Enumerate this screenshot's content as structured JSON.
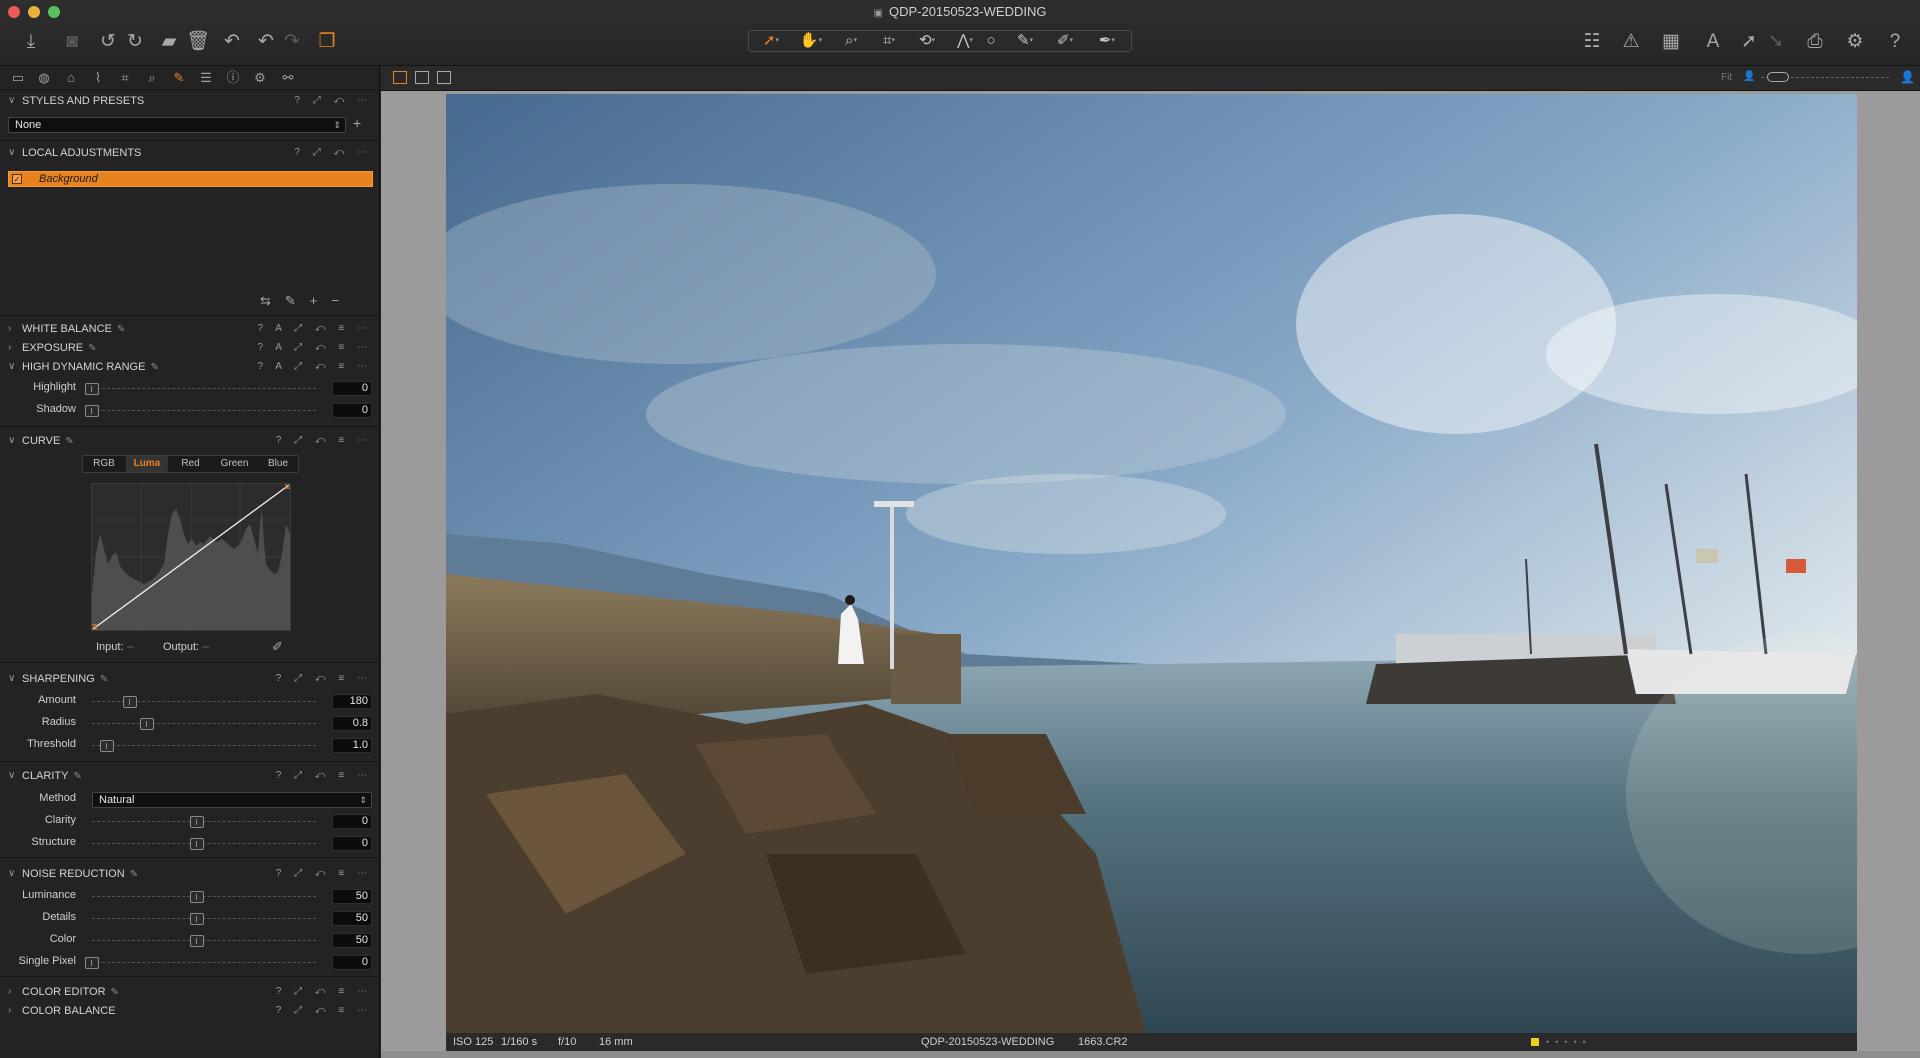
{
  "window": {
    "title": "QDP-20150523-WEDDING"
  },
  "toolbar": {
    "left_icons": [
      "import-icon",
      "camera-icon",
      "rotate-left-icon",
      "rotate-right-icon",
      "move-folder-icon",
      "trash-icon",
      "undo-history-icon",
      "undo-icon",
      "redo-icon",
      "stack-icon"
    ],
    "center_tools": [
      "pointer-tool",
      "pan-tool",
      "loupe-tool",
      "crop-tool",
      "rotate-tool",
      "keystone-tool",
      "spot-removal-tool",
      "brush-tool",
      "picker-tool",
      "erase-tool"
    ],
    "right_icons": [
      "layout-icon",
      "warning-icon",
      "grid-icon",
      "text-overlay-icon",
      "export-icon",
      "import-export-icon",
      "print-icon",
      "settings-icon",
      "help-icon"
    ]
  },
  "sections": {
    "styles": {
      "title": "STYLES AND PRESETS",
      "preset_value": "None"
    },
    "local": {
      "title": "LOCAL ADJUSTMENTS",
      "layer_name": "Background"
    },
    "white_balance": {
      "title": "WHITE BALANCE"
    },
    "exposure": {
      "title": "EXPOSURE"
    },
    "hdr": {
      "title": "HIGH DYNAMIC RANGE",
      "rows": [
        {
          "label": "Highlight",
          "value": "0",
          "level": 0
        },
        {
          "label": "Shadow",
          "value": "0",
          "level": 0
        }
      ]
    },
    "curve": {
      "title": "CURVE",
      "tabs": [
        "RGB",
        "Luma",
        "Red",
        "Green",
        "Blue"
      ],
      "active_tab": "Luma",
      "input_label": "Input:",
      "input_value": "--",
      "output_label": "Output:",
      "output_value": "--"
    },
    "sharpening": {
      "title": "SHARPENING",
      "rows": [
        {
          "label": "Amount",
          "value": "180",
          "level": 0.18
        },
        {
          "label": "Radius",
          "value": "0.8",
          "level": 0.26
        },
        {
          "label": "Threshold",
          "value": "1.0",
          "level": 0.07
        }
      ]
    },
    "clarity": {
      "title": "CLARITY",
      "method_label": "Method",
      "method_value": "Natural",
      "rows": [
        {
          "label": "Clarity",
          "value": "0",
          "level": 0.5
        },
        {
          "label": "Structure",
          "value": "0",
          "level": 0.5
        }
      ]
    },
    "noise": {
      "title": "NOISE REDUCTION",
      "rows": [
        {
          "label": "Luminance",
          "value": "50",
          "level": 0.5
        },
        {
          "label": "Details",
          "value": "50",
          "level": 0.5
        },
        {
          "label": "Color",
          "value": "50",
          "level": 0.5
        },
        {
          "label": "Single Pixel",
          "value": "0",
          "level": 0
        }
      ]
    },
    "color_editor": {
      "title": "COLOR EDITOR"
    },
    "color_balance": {
      "title": "COLOR BALANCE"
    }
  },
  "viewer": {
    "fit_label": "Fit",
    "info": {
      "iso": "ISO 125",
      "shutter": "1/160 s",
      "aperture": "f/10",
      "focal": "16 mm",
      "session": "QDP-20150523-WEDDING",
      "filename": "1663.CR2"
    }
  },
  "colors": {
    "accent": "#e8821e",
    "panel": "#232323",
    "viewer_bg": "#9b9b9b"
  }
}
